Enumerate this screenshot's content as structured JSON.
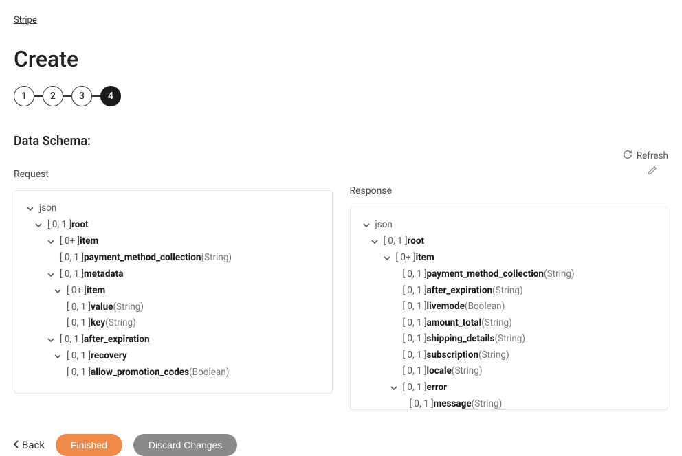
{
  "breadcrumb": "Stripe",
  "page_title": "Create",
  "stepper": {
    "steps": [
      "1",
      "2",
      "3",
      "4"
    ],
    "active_index": 3
  },
  "section_title": "Data Schema:",
  "columns": {
    "request": {
      "label": "Request"
    },
    "response": {
      "label": "Response",
      "refresh_label": "Refresh"
    }
  },
  "request_tree": [
    {
      "indent": 0,
      "chevron": true,
      "card": "",
      "name": "json",
      "type": ""
    },
    {
      "indent": 1,
      "chevron": true,
      "card": "[ 0, 1 ]",
      "name": "root",
      "type": ""
    },
    {
      "indent": 2,
      "chevron": true,
      "card": "[ 0+ ]",
      "name": "item",
      "type": ""
    },
    {
      "indent": 2,
      "chevron": false,
      "card": "[ 0, 1 ]",
      "name": "payment_method_collection",
      "type": "(String)"
    },
    {
      "indent": 2,
      "chevron": true,
      "card": "[ 0, 1 ]",
      "name": "metadata",
      "type": ""
    },
    {
      "indent": 3,
      "chevron": true,
      "card": "[ 0+ ]",
      "name": "item",
      "type": ""
    },
    {
      "indent": 3,
      "chevron": false,
      "card": "[ 0, 1 ]",
      "name": "value",
      "type": "(String)"
    },
    {
      "indent": 3,
      "chevron": false,
      "card": "[ 0, 1 ]",
      "name": "key",
      "type": "(String)"
    },
    {
      "indent": 2,
      "chevron": true,
      "card": "[ 0, 1 ]",
      "name": "after_expiration",
      "type": ""
    },
    {
      "indent": 3,
      "chevron": true,
      "card": "[ 0, 1 ]",
      "name": "recovery",
      "type": ""
    },
    {
      "indent": 3,
      "chevron": false,
      "card": "[ 0, 1 ]",
      "name": "allow_promotion_codes",
      "type": "(Boolean)"
    }
  ],
  "response_tree": [
    {
      "indent": 0,
      "chevron": true,
      "card": "",
      "name": "json",
      "type": ""
    },
    {
      "indent": 1,
      "chevron": true,
      "card": "[ 0, 1 ]",
      "name": "root",
      "type": ""
    },
    {
      "indent": 2,
      "chevron": true,
      "card": "[ 0+ ]",
      "name": "item",
      "type": ""
    },
    {
      "indent": 3,
      "chevron": false,
      "card": "[ 0, 1 ]",
      "name": "payment_method_collection",
      "type": "(String)"
    },
    {
      "indent": 3,
      "chevron": false,
      "card": "[ 0, 1 ]",
      "name": "after_expiration",
      "type": "(String)"
    },
    {
      "indent": 3,
      "chevron": false,
      "card": "[ 0, 1 ]",
      "name": "livemode",
      "type": "(Boolean)"
    },
    {
      "indent": 3,
      "chevron": false,
      "card": "[ 0, 1 ]",
      "name": "amount_total",
      "type": "(String)"
    },
    {
      "indent": 3,
      "chevron": false,
      "card": "[ 0, 1 ]",
      "name": "shipping_details",
      "type": "(String)"
    },
    {
      "indent": 3,
      "chevron": false,
      "card": "[ 0, 1 ]",
      "name": "subscription",
      "type": "(String)"
    },
    {
      "indent": 3,
      "chevron": false,
      "card": "[ 0, 1 ]",
      "name": "locale",
      "type": "(String)"
    },
    {
      "indent": 3,
      "chevron": true,
      "card": "[ 0, 1 ]",
      "name": "error",
      "type": ""
    },
    {
      "indent": 4,
      "chevron": false,
      "card": "[ 0, 1 ]",
      "name": "message",
      "type": "(String)"
    }
  ],
  "footer": {
    "back_label": "Back",
    "finished_label": "Finished",
    "discard_label": "Discard Changes"
  }
}
